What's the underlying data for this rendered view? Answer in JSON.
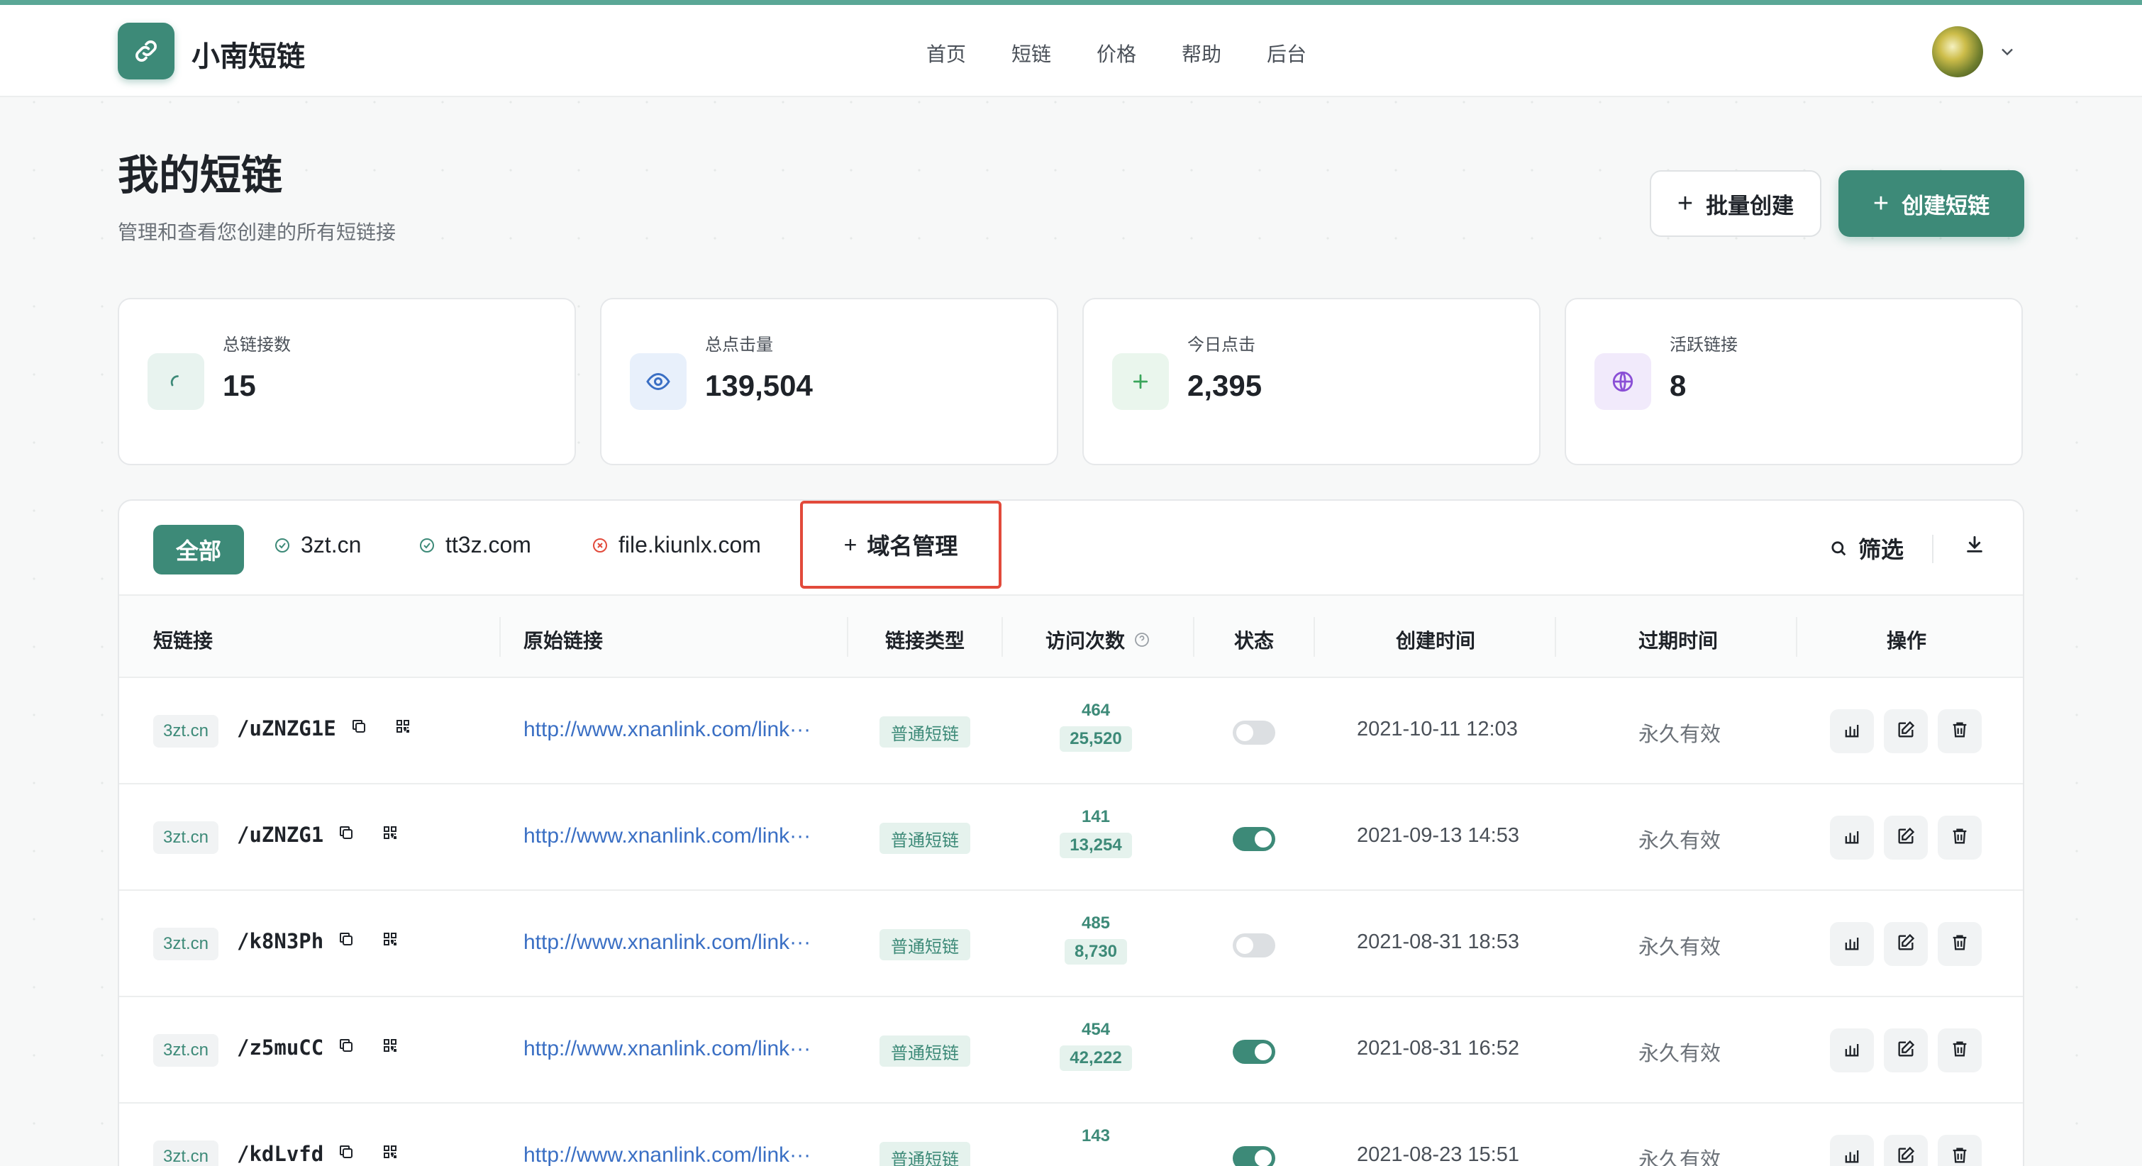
{
  "nav": {
    "brand": "小南短链",
    "items": [
      "首页",
      "短链",
      "价格",
      "帮助",
      "后台"
    ]
  },
  "header": {
    "title": "我的短链",
    "subtitle": "管理和查看您创建的所有短链接",
    "batch_label": "批量创建",
    "create_label": "创建短链"
  },
  "stats": [
    {
      "label": "总链接数",
      "value": "15",
      "icon": "link-icon",
      "color": "#3d8a78",
      "bg": "#e8f3ef"
    },
    {
      "label": "总点击量",
      "value": "139,504",
      "icon": "eye-icon",
      "color": "#3a6fc4",
      "bg": "#e8f0fb"
    },
    {
      "label": "今日点击",
      "value": "2,395",
      "icon": "plus-icon",
      "color": "#3aa55b",
      "bg": "#eaf6ed"
    },
    {
      "label": "活跃链接",
      "value": "8",
      "icon": "globe-icon",
      "color": "#8a4fd6",
      "bg": "#f1eafb"
    }
  ],
  "tabs": {
    "all": "全部",
    "domains": [
      {
        "name": "3zt.cn",
        "status": "ok"
      },
      {
        "name": "tt3z.com",
        "status": "ok"
      },
      {
        "name": "file.kiunlx.com",
        "status": "error"
      }
    ],
    "domain_manage": "域名管理",
    "filter": "筛选"
  },
  "table": {
    "headers": [
      "短链接",
      "原始链接",
      "链接类型",
      "访问次数",
      "状态",
      "创建时间",
      "过期时间",
      "操作"
    ],
    "rows": [
      {
        "domain": "3zt.cn",
        "code": "/uZNZG1E",
        "original": "http://www.xnanlink.com/link···",
        "type": "普通短链",
        "visits_today": "464",
        "visits_total": "25,520",
        "enabled": false,
        "created": "2021-10-11 12:03",
        "expires": "永久有效"
      },
      {
        "domain": "3zt.cn",
        "code": "/uZNZG1",
        "original": "http://www.xnanlink.com/link···",
        "type": "普通短链",
        "visits_today": "141",
        "visits_total": "13,254",
        "enabled": true,
        "created": "2021-09-13 14:53",
        "expires": "永久有效"
      },
      {
        "domain": "3zt.cn",
        "code": "/k8N3Ph",
        "original": "http://www.xnanlink.com/link···",
        "type": "普通短链",
        "visits_today": "485",
        "visits_total": "8,730",
        "enabled": false,
        "created": "2021-08-31 18:53",
        "expires": "永久有效"
      },
      {
        "domain": "3zt.cn",
        "code": "/z5muCC",
        "original": "http://www.xnanlink.com/link···",
        "type": "普通短链",
        "visits_today": "454",
        "visits_total": "42,222",
        "enabled": true,
        "created": "2021-08-31 16:52",
        "expires": "永久有效"
      },
      {
        "domain": "3zt.cn",
        "code": "/kdLvfd",
        "original": "http://www.xnanlink.com/link···",
        "type": "普通短链",
        "visits_today": "143",
        "visits_total": "",
        "enabled": true,
        "created": "2021-08-23 15:51",
        "expires": "永久有效"
      }
    ]
  }
}
